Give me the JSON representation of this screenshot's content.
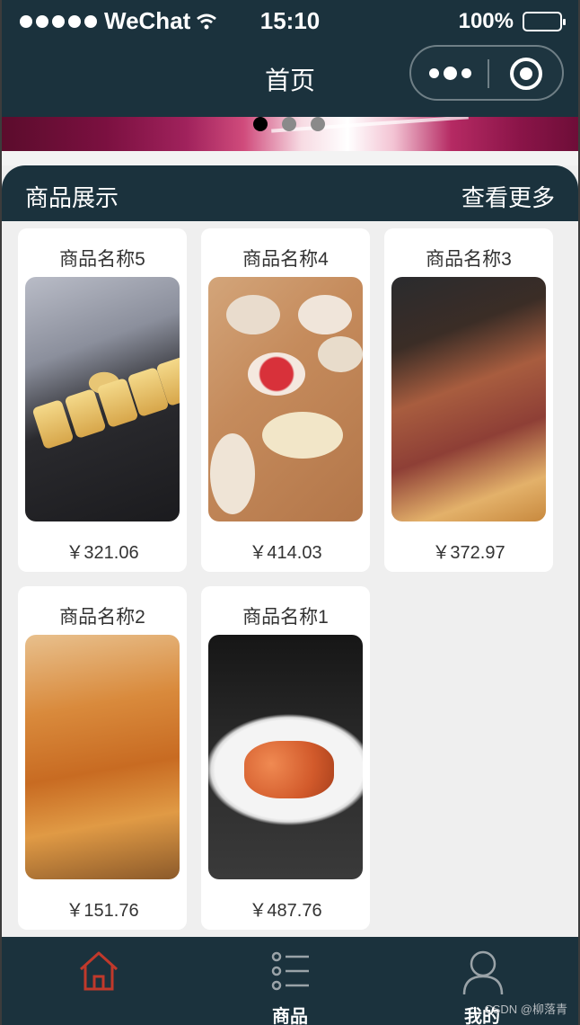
{
  "status_bar": {
    "carrier": "WeChat",
    "time": "15:10",
    "battery": "100%"
  },
  "nav": {
    "title": "首页"
  },
  "banner": {
    "indicator_count": 3,
    "active_index": 0
  },
  "section": {
    "title": "商品展示",
    "more_label": "查看更多"
  },
  "products": [
    {
      "name": "商品名称5",
      "price": "￥321.06",
      "image": "fried-rolls-photo"
    },
    {
      "name": "商品名称4",
      "price": "￥414.03",
      "image": "dim-sum-box-photo"
    },
    {
      "name": "商品名称3",
      "price": "￥372.97",
      "image": "meat-flatbread-photo"
    },
    {
      "name": "商品名称2",
      "price": "￥151.76",
      "image": "sesame-pastry-photo"
    },
    {
      "name": "商品名称1",
      "price": "￥487.76",
      "image": "shrimp-dish-photo"
    }
  ],
  "tabbar": {
    "items": [
      {
        "label": "",
        "icon": "home-icon",
        "active": true
      },
      {
        "label": "商品",
        "icon": "list-icon",
        "active": false
      },
      {
        "label": "我的",
        "icon": "user-icon",
        "active": false
      }
    ]
  },
  "watermark": "CSDN @柳落青",
  "colors": {
    "header_bg": "#1b323d",
    "page_bg": "#efefef",
    "active_icon": "#c0392b"
  }
}
